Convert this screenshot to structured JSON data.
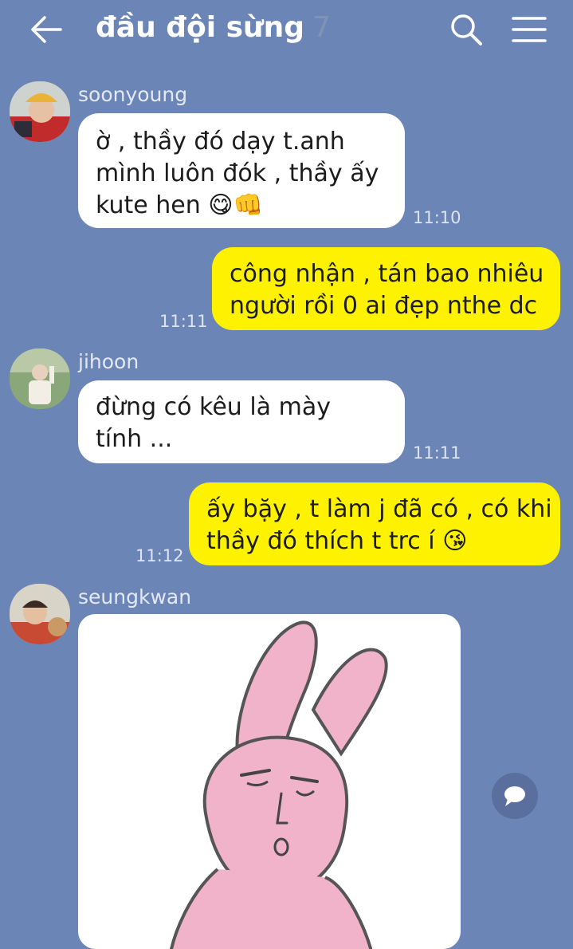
{
  "header": {
    "title": "đầu đội sừng",
    "member_count": "7"
  },
  "messages": [
    {
      "sender": "soonyoung",
      "text_lines": [
        "ờ , thầy đó dạy t.anh",
        "mình luôn đók , thầy ấy",
        "kute hen 😋👊"
      ],
      "time": "11:10"
    },
    {
      "text_lines": [
        "công nhận , tán bao nhiêu",
        "người rồi 0 ai đẹp nthe dc"
      ],
      "time": "11:11"
    },
    {
      "sender": "jihoon",
      "text_lines": [
        "đừng có kêu là mày",
        "tính ..."
      ],
      "time": "11:11"
    },
    {
      "text_lines": [
        "ấy bặy , t làm j đã có , có khi",
        "thầy đó thích t trc í 😘"
      ],
      "time": "11:12"
    },
    {
      "sender": "seungkwan"
    }
  ],
  "colors": {
    "background": "#6b85b6",
    "incoming_bubble": "#ffffff",
    "outgoing_bubble": "#fff200"
  }
}
